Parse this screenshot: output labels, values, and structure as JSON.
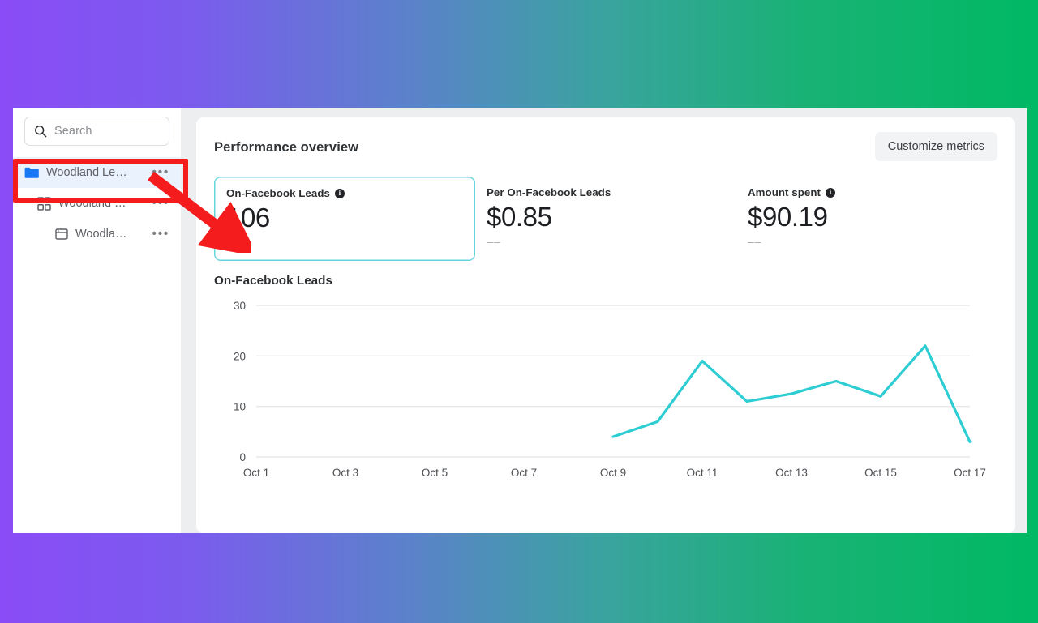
{
  "background": {
    "from": "#8a4cf6",
    "to": "#00b964"
  },
  "sidebar": {
    "search": {
      "placeholder": "Search",
      "icon": "search-icon"
    },
    "items": [
      {
        "label": "Woodland Le…",
        "icon": "folder-icon",
        "level": 0,
        "selected": true,
        "menu": "•••"
      },
      {
        "label": "Woodland …",
        "icon": "grid-icon",
        "level": 1,
        "selected": false,
        "menu": "•••"
      },
      {
        "label": "Woodla…",
        "icon": "window-icon",
        "level": 2,
        "selected": false,
        "menu": "•••"
      }
    ]
  },
  "main": {
    "title": "Performance overview",
    "customize_label": "Customize metrics",
    "metrics": [
      {
        "label": "On-Facebook Leads",
        "value": "106",
        "sub": "––",
        "has_info": true,
        "selected": true
      },
      {
        "label": "Per On-Facebook Leads",
        "value": "$0.85",
        "sub": "––",
        "has_info": false,
        "selected": false
      },
      {
        "label": "Amount spent",
        "value": "$90.19",
        "sub": "––",
        "has_info": true,
        "selected": false
      }
    ],
    "chart_title": "On-Facebook Leads"
  },
  "chart_data": {
    "type": "line",
    "title": "On-Facebook Leads",
    "xlabel": "",
    "ylabel": "",
    "line_color": "#2dcdd3",
    "grid": true,
    "legend": false,
    "ylim": [
      0,
      30
    ],
    "yticks": [
      0,
      10,
      20,
      30
    ],
    "ytick_labels": [
      "0",
      "10",
      "20",
      "30"
    ],
    "x": [
      "Oct 1",
      "Oct 2",
      "Oct 3",
      "Oct 4",
      "Oct 5",
      "Oct 6",
      "Oct 7",
      "Oct 8",
      "Oct 9",
      "Oct 10",
      "Oct 11",
      "Oct 12",
      "Oct 13",
      "Oct 14",
      "Oct 15",
      "Oct 16",
      "Oct 17"
    ],
    "xtick_labels": [
      "Oct 1",
      "Oct 3",
      "Oct 5",
      "Oct 7",
      "Oct 9",
      "Oct 11",
      "Oct 13",
      "Oct 15",
      "Oct 17"
    ],
    "series": [
      {
        "name": "On-Facebook Leads",
        "values": [
          null,
          null,
          null,
          null,
          null,
          null,
          null,
          null,
          4,
          7,
          19,
          11,
          12.5,
          15,
          12,
          22,
          3
        ]
      }
    ]
  },
  "annotation": {
    "highlight_color": "#f41c1c",
    "target": "sidebar-item-0"
  }
}
